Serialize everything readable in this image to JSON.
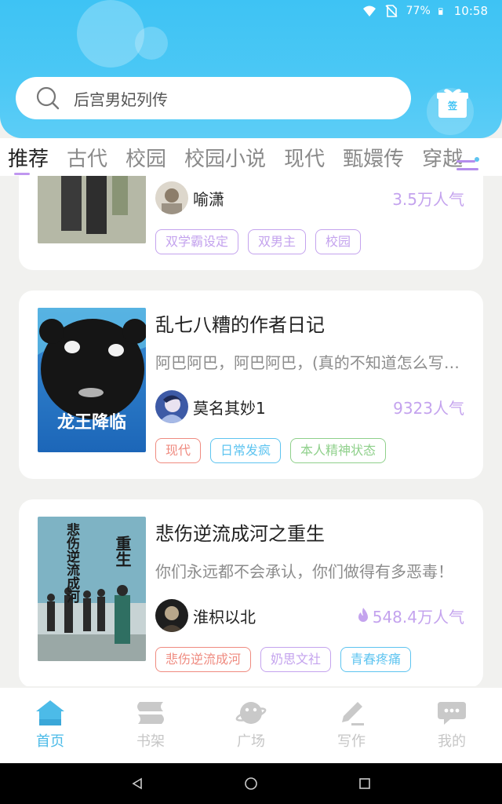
{
  "statusbar": {
    "battery": "77%",
    "time": "10:58"
  },
  "search": {
    "placeholder": "后宫男妃列传"
  },
  "gift": {
    "label": "签"
  },
  "tabs": [
    {
      "label": "推荐",
      "active": true
    },
    {
      "label": "古代"
    },
    {
      "label": "校园"
    },
    {
      "label": "校园小说"
    },
    {
      "label": "现代"
    },
    {
      "label": "甄嬛传"
    },
    {
      "label": "穿越"
    }
  ],
  "books": [
    {
      "author": "喻潇",
      "popularity": "3.5万人气",
      "tags": [
        {
          "label": "双学霸设定",
          "color": "#c4a3ee"
        },
        {
          "label": "双男主",
          "color": "#c4a3ee"
        },
        {
          "label": "校园",
          "color": "#c4a3ee"
        }
      ]
    },
    {
      "title": "乱七八糟的作者日记",
      "description": "阿巴阿巴，阿巴阿巴，(真的不知道怎么写简介)",
      "cover_text": "龙王降临",
      "author": "莫名其妙1",
      "popularity": "9323人气",
      "tags": [
        {
          "label": "现代",
          "color": "#ef8b80"
        },
        {
          "label": "日常发疯",
          "color": "#5ec4f0"
        },
        {
          "label": "本人精神状态",
          "color": "#8fd08b"
        }
      ]
    },
    {
      "title": "悲伤逆流成河之重生",
      "description": "你们永远都不会承认，你们做得有多恶毒！",
      "cover_text_main": "悲伤逆流成河",
      "cover_text_side": "重生",
      "author": "淮枳以北",
      "popularity": "548.4万人气",
      "tags": [
        {
          "label": "悲伤逆流成河",
          "color": "#ef8b80"
        },
        {
          "label": "奶思文社",
          "color": "#c4a3ee"
        },
        {
          "label": "青春疼痛",
          "color": "#5ec4f0"
        }
      ]
    }
  ],
  "bottom_nav": [
    {
      "label": "首页",
      "icon": "home-icon",
      "active": true
    },
    {
      "label": "书架",
      "icon": "bookshelf-icon"
    },
    {
      "label": "广场",
      "icon": "planet-icon"
    },
    {
      "label": "写作",
      "icon": "pen-icon"
    },
    {
      "label": "我的",
      "icon": "chat-bubble-icon"
    }
  ],
  "colors": {
    "accent": "#4cc8f5",
    "purple": "#c4a3ee"
  }
}
